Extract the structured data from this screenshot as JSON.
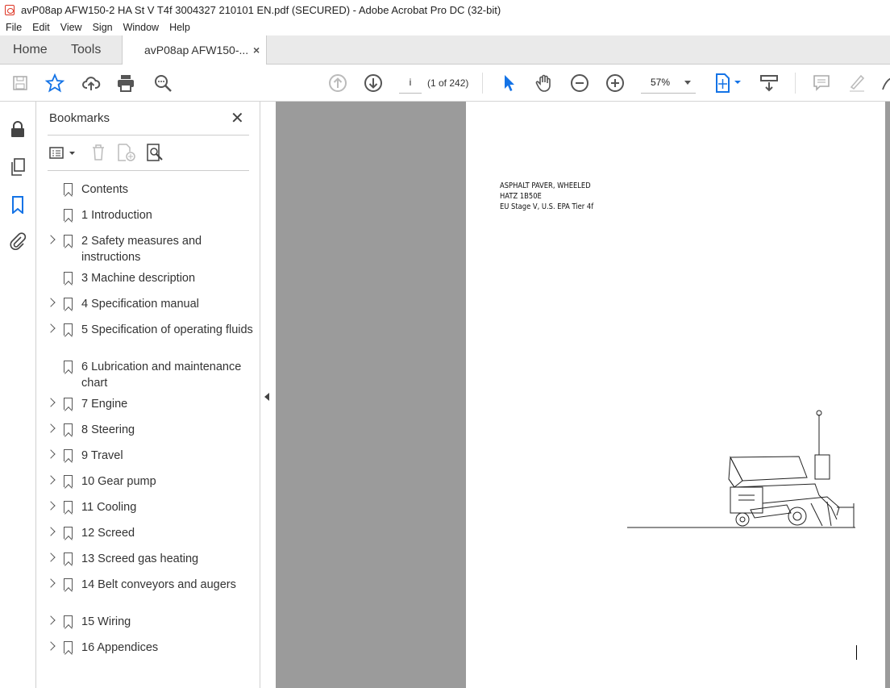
{
  "window": {
    "title": "avP08ap AFW150-2 HA St V T4f 3004327 210101 EN.pdf (SECURED) - Adobe Acrobat Pro DC (32-bit)"
  },
  "menu": [
    "File",
    "Edit",
    "View",
    "Sign",
    "Window",
    "Help"
  ],
  "tabs": {
    "home": "Home",
    "tools": "Tools",
    "document": "avP08ap AFW150-...",
    "close": "×"
  },
  "toolbar": {
    "page_value": "i",
    "page_count": "(1 of 242)",
    "zoom": "57%"
  },
  "bookmarks": {
    "title": "Bookmarks",
    "close": "✕",
    "items": [
      {
        "label": "Contents",
        "expandable": false
      },
      {
        "label": "1 Introduction",
        "expandable": false
      },
      {
        "label": "2 Safety measures and instructions",
        "expandable": true
      },
      {
        "label": "3 Machine description",
        "expandable": false
      },
      {
        "label": "4 Specification manual",
        "expandable": true
      },
      {
        "label": "5 Specification of operating fluids",
        "expandable": true
      },
      {
        "label": "6 Lubrication and maintenance chart",
        "expandable": false
      },
      {
        "label": "7 Engine",
        "expandable": true
      },
      {
        "label": "8 Steering",
        "expandable": true
      },
      {
        "label": "9 Travel",
        "expandable": true
      },
      {
        "label": "10 Gear pump",
        "expandable": true
      },
      {
        "label": "11 Cooling",
        "expandable": true
      },
      {
        "label": "12 Screed",
        "expandable": true
      },
      {
        "label": "13 Screed gas heating",
        "expandable": true
      },
      {
        "label": "14 Belt conveyors and augers",
        "expandable": true
      },
      {
        "label": "15 Wiring",
        "expandable": true
      },
      {
        "label": "16 Appendices",
        "expandable": true
      }
    ]
  },
  "document": {
    "lines": [
      "ASPHALT PAVER, WHEELED",
      "HATZ 1B50E",
      "EU Stage V, U.S. EPA Tier 4f"
    ]
  },
  "colors": {
    "accent": "#1473e6",
    "viewer_bg": "#9b9b9b"
  }
}
